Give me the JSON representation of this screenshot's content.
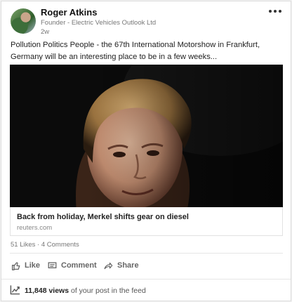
{
  "author": {
    "name": "Roger Atkins",
    "title": "Founder - Electric Vehicles Outlook Ltd",
    "time": "2w"
  },
  "post": {
    "text": "Pollution Politics People - the 67th International Motorshow in Frankfurt, Germany will be an interesting place to be in a few weeks..."
  },
  "link": {
    "title": "Back from holiday, Merkel shifts gear on diesel",
    "domain": "reuters.com"
  },
  "stats": {
    "likes": "51 Likes",
    "separator": " · ",
    "comments": "4 Comments"
  },
  "actions": {
    "like": "Like",
    "comment": "Comment",
    "share": "Share"
  },
  "footer": {
    "views": "11,848 views",
    "rest": " of your post in the feed"
  },
  "colors": {
    "accent_icon": "#555555",
    "image_background": "#0b0b0b"
  },
  "icons": {
    "more": "more-horizontal-icon",
    "like": "thumbs-up-icon",
    "comment": "comment-icon",
    "share": "share-arrow-icon",
    "views": "trending-chart-icon"
  }
}
